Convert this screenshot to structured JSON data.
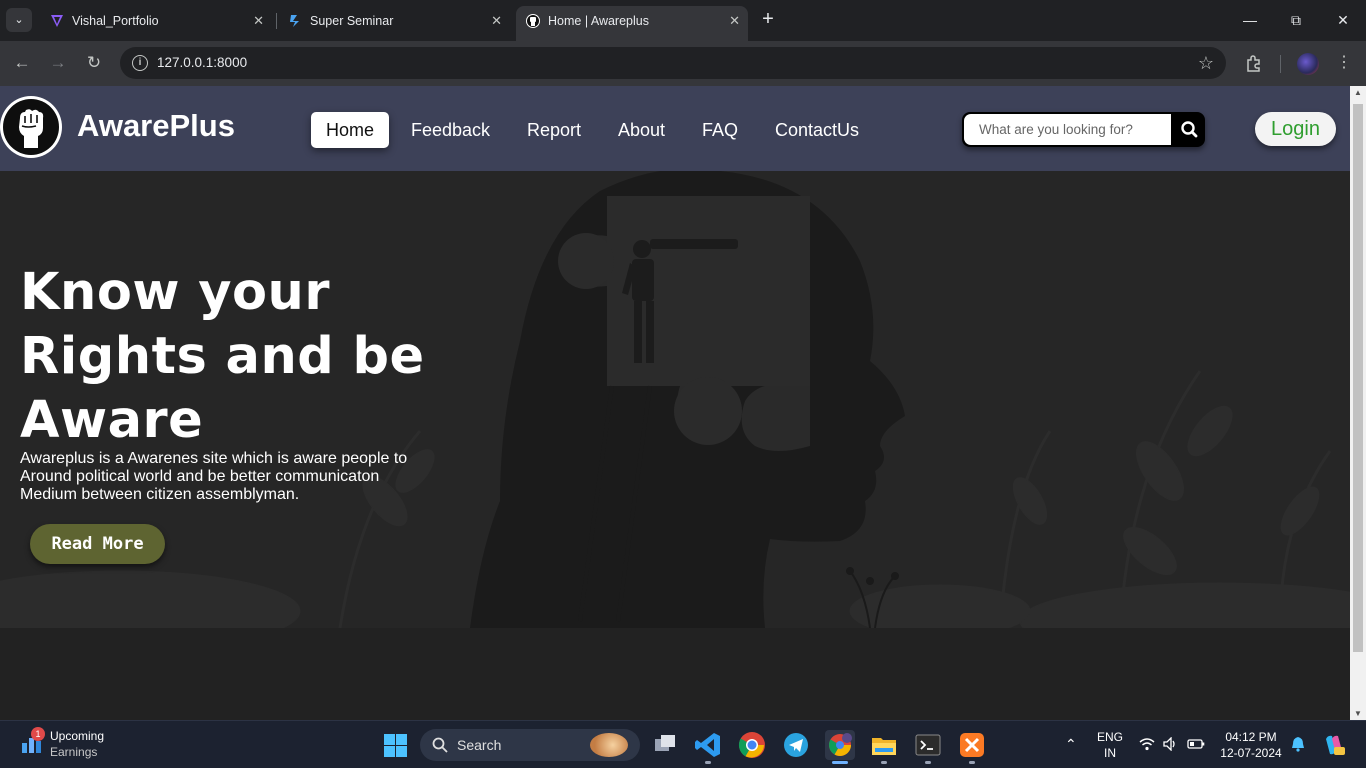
{
  "browser": {
    "tabs": [
      {
        "title": "Vishal_Portfolio",
        "icon": "vite-icon"
      },
      {
        "title": "Super Seminar",
        "icon": "seminar-icon"
      },
      {
        "title": "Home | Awareplus",
        "icon": "fist-icon"
      }
    ],
    "url": "127.0.0.1:8000"
  },
  "site": {
    "brand": "AwarePlus",
    "nav": [
      "Home",
      "Feedback",
      "Report",
      "About",
      "FAQ",
      "ContactUs"
    ],
    "search_placeholder": "What are you looking for?",
    "login_label": "Login"
  },
  "hero": {
    "title": "Know your Rights and be Aware",
    "description": "Awareplus is a Awarenes site which is aware people to Around political world and be better communicaton Medium between citizen assemblyman.",
    "cta_label": "Read More"
  },
  "taskbar": {
    "widget_title": "Upcoming",
    "widget_subtitle": "Earnings",
    "widget_badge": "1",
    "search_label": "Search",
    "lang_line1": "ENG",
    "lang_line2": "IN",
    "time": "04:12 PM",
    "date": "12-07-2024"
  },
  "colors": {
    "header_bg": "#3d4158",
    "hero_bg": "#262626",
    "cta_bg": "#5e6431",
    "login_text": "#2f9e2f"
  }
}
